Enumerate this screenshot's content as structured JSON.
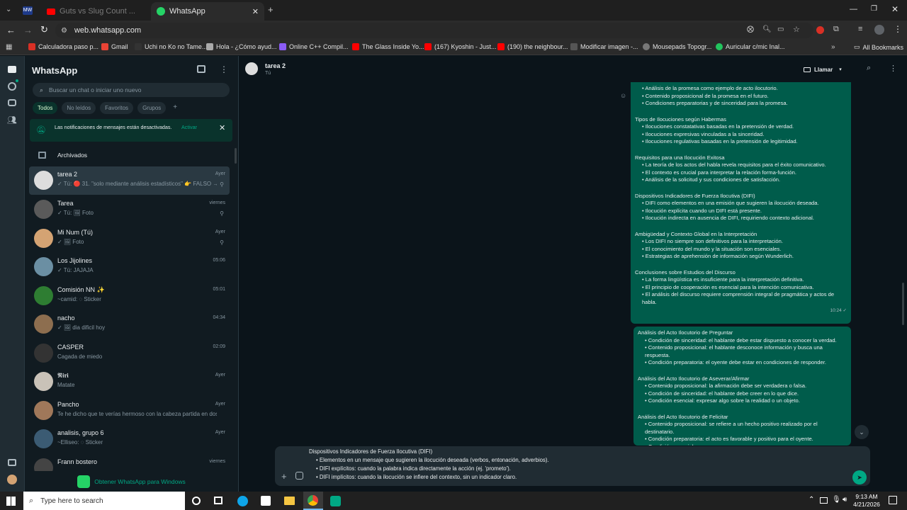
{
  "browser": {
    "tabs": [
      {
        "label": "Guts vs Slug Count ..."
      },
      {
        "label": "WhatsApp"
      }
    ],
    "url": "web.whatsapp.com",
    "bookmarks": [
      "Calculadora paso p...",
      "Gmail",
      "Uchi no Ko no Tame...",
      "Hola - ¿Cómo ayud...",
      "Online C++ Compil...",
      "The Glass Inside Yo...",
      "(167) Kyoshin - Just...",
      "(190) the neighbour...",
      "Modificar imagen -...",
      "Mousepads Topogr...",
      "Auricular c/mic Inal...",
      "All Bookmarks"
    ]
  },
  "sidebar": {
    "title": "WhatsApp",
    "search_placeholder": "Buscar un chat o iniciar uno nuevo",
    "filters": [
      "Todos",
      "No leídos",
      "Favoritos",
      "Grupos"
    ],
    "notice": {
      "text": "Las notificaciones de mensajes están desactivadas.",
      "action": "Activar"
    },
    "archived": "Archivados",
    "chats": [
      {
        "name": "tarea 2",
        "preview": "✓ Tú: 🔴 31. \"solo mediante análisis estadísticos\" 👉 FALSO → ...",
        "time": "Ayer"
      },
      {
        "name": "Tarea",
        "preview": "✓ Tú: 🖼 Foto",
        "time": "viernes"
      },
      {
        "name": "Mi Num (Tú)",
        "preview": "✓ 🖼 Foto",
        "time": "Ayer"
      },
      {
        "name": "Los Jijolines",
        "preview": "✓ Tú: JAJAJA",
        "time": "05:06"
      },
      {
        "name": "Comisión NN ✨",
        "preview": "~camid: ◌ Sticker",
        "time": "05:01"
      },
      {
        "name": "nacho",
        "preview": "✓ 🖼 dia dificil hoy",
        "time": "04:34"
      },
      {
        "name": "CASPER",
        "preview": "Cagada de miedo",
        "time": "02:09"
      },
      {
        "name": "𝕽𝖎𝖗𝖎",
        "preview": "Matate",
        "time": "Ayer"
      },
      {
        "name": "Pancho",
        "preview": "Te he dicho que te verías hermoso con la cabeza partida en dos ...",
        "time": "Ayer"
      },
      {
        "name": "analisis, grupo 6",
        "preview": "~Elliseo: ◌ Sticker",
        "time": "Ayer"
      },
      {
        "name": "Frann bostero",
        "preview": "",
        "time": "viernes"
      }
    ],
    "get_app": "Obtener WhatsApp para Windows"
  },
  "chat_header": {
    "name": "tarea 2",
    "subtitle": "Tú",
    "call_label": "Llamar"
  },
  "message1": {
    "sections": [
      {
        "heading": "",
        "items": [
          "Análisis de la promesa como ejemplo de acto ilocutorio.",
          "Contenido proposicional de la promesa en el futuro.",
          "Condiciones preparatorias y de sinceridad para la promesa."
        ]
      },
      {
        "heading": "Tipos de Ilocuciones según Habermas",
        "items": [
          "Ilocuciones constatativas basadas en la pretensión de verdad.",
          "Ilocuciones expresivas vinculadas a la sinceridad.",
          "Ilocuciones regulativas basadas en la pretensión de legitimidad."
        ]
      },
      {
        "heading": "Requisitos para una Ilocución Exitosa",
        "items": [
          "La teoría de los actos del habla revela requisitos para el éxito comunicativo.",
          "El contexto es crucial para interpretar la relación forma-función.",
          "Análisis de la solicitud y sus condiciones de satisfacción."
        ]
      },
      {
        "heading": "Dispositivos Indicadores de Fuerza Ilocutiva (DIFI)",
        "items": [
          "DIFI como elementos en una emisión que sugieren la ilocución deseada.",
          "Ilocución explícita cuando un DIFI está presente.",
          "Ilocución indirecta en ausencia de DIFI, requiriendo contexto adicional."
        ]
      },
      {
        "heading": "Ambigüedad y Contexto Global en la Interpretación",
        "items": [
          "Los DIFI no siempre son definitivos para la interpretación.",
          "El conocimiento del mundo y la situación son esenciales.",
          "Estrategias de aprehensión de información según Wunderlich."
        ]
      },
      {
        "heading": "Conclusiones sobre Estudios del Discurso",
        "items": [
          "La forma lingüística es insuficiente para la interpretación definitiva.",
          "El principio de cooperación es esencial para la intención comunicativa.",
          "El análisis del discurso requiere comprensión integral de pragmática y actos de habla."
        ]
      }
    ],
    "time": "10:24 ✓"
  },
  "message2": {
    "sections": [
      {
        "heading": "Análisis del Acto Ilocutorio de Preguntar",
        "items": [
          "Condición de sinceridad: el hablante debe estar dispuesto a conocer la verdad.",
          "Contenido proposicional: el hablante desconoce información y busca una respuesta.",
          "Condición preparatoria: el oyente debe estar en condiciones de responder."
        ]
      },
      {
        "heading": "Análisis del Acto Ilocutorio de Aseverar/Afirmar",
        "items": [
          "Contenido proposicional: la afirmación debe ser verdadera o falsa.",
          "Condición de sinceridad: el hablante debe creer en lo que dice.",
          "Condición esencial: expresar algo sobre la realidad o un objeto."
        ]
      },
      {
        "heading": "Análisis del Acto Ilocutorio de Felicitar",
        "items": [
          "Contenido proposicional: se refiere a un hecho positivo realizado por el destinatario.",
          "Condición preparatoria: el acto es favorable y positivo para el oyente.",
          "Condición esencial: expresar recon"
        ]
      }
    ]
  },
  "composer": {
    "lines": [
      "Dispositivos Indicadores de Fuerza Ilocutiva (DIFI)",
      "• Elementos en un mensaje que sugieren la ilocución deseada (verbos, entonación, adverbios).",
      "• DIFI explícitos: cuando la palabra indica directamente la acción (ej. 'prometo').",
      "• DIFI implícitos: cuando la ilocución se infiere del contexto, sin un indicador claro."
    ]
  },
  "taskbar": {
    "search_placeholder": "Type here to search",
    "time": "9:13 AM",
    "date": "4/21/2026"
  },
  "colors": {
    "accent": "#00a884",
    "bubble_out": "#005c4b",
    "panel": "#111b21"
  }
}
